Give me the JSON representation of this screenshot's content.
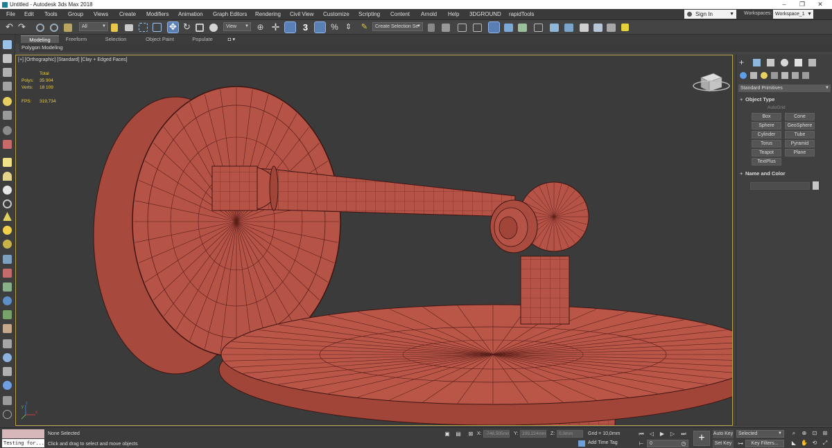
{
  "window": {
    "title": "Untitled - Autodesk 3ds Max 2018",
    "min": "–",
    "max": "❐",
    "close": "✕"
  },
  "menu": {
    "items": [
      "File",
      "Edit",
      "Tools",
      "Group",
      "Views",
      "Create",
      "Modifiers",
      "Animation",
      "Graph Editors",
      "Rendering",
      "Civil View",
      "Customize",
      "Scripting",
      "Content",
      "Arnold",
      "Help",
      "3DGROUND",
      "rapidTools"
    ],
    "sign_in": "Sign In",
    "workspaces_label": "Workspaces:",
    "workspace_value": "Workspace_1"
  },
  "toolbar": {
    "selection_filter": "All",
    "ref_coord": "View",
    "snap_toggle": "3",
    "named_selection": "Create Selection Se"
  },
  "ribbon": {
    "tabs": [
      "Modeling",
      "Freeform",
      "Selection",
      "Object Paint",
      "Populate"
    ],
    "active_tab": "Modeling",
    "panel_label": "Polygon Modeling"
  },
  "viewport": {
    "label": "[+] [Orthographic] [Standard] [Clay + Edged Faces]",
    "stats": {
      "total_label": "Total",
      "polys_label": "Polys:",
      "polys_value": "35 904",
      "verts_label": "Verts:",
      "verts_value": "18 109",
      "fps_label": "FPS:",
      "fps_value": "319,734"
    },
    "axis": {
      "x": "x",
      "y": "y",
      "z": "z"
    },
    "mesh_color": "#b65347",
    "wire_color": "#5a1f1a",
    "border_color": "#b9a64a"
  },
  "command_panel": {
    "category": "Standard Primitives",
    "object_type_title": "Object Type",
    "autogrid": "AutoGrid",
    "primitives": [
      "Box",
      "Cone",
      "Sphere",
      "GeoSphere",
      "Cylinder",
      "Tube",
      "Torus",
      "Pyramid",
      "Teapot",
      "Plane",
      "TextPlus"
    ],
    "name_and_color_title": "Name and Color"
  },
  "status": {
    "listener_output": "Testing for...",
    "selection": "None Selected",
    "prompt": "Click and drag to select and move objects",
    "x_label": "X:",
    "x_value": "-748,505mm",
    "y_label": "Y:",
    "y_value": "209,224mm",
    "z_label": "Z:",
    "z_value": "0,0mm",
    "grid": "Grid = 10,0mm",
    "add_time_tag": "Add Time Tag",
    "frame": "0",
    "auto_key": "Auto Key",
    "set_key": "Set Key",
    "selected": "Selected",
    "key_filters": "Key Filters..."
  }
}
